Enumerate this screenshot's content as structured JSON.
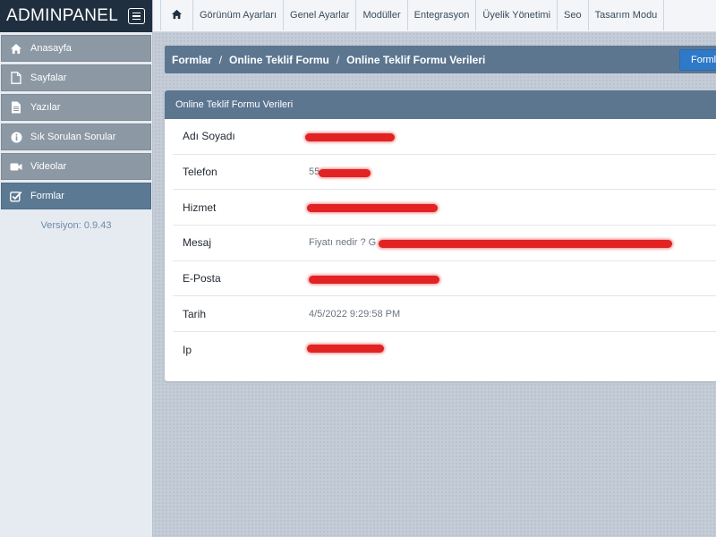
{
  "brand": {
    "title": "ADMINPANEL"
  },
  "sidebar": {
    "items": [
      {
        "label": "Anasayfa",
        "icon": "home-icon"
      },
      {
        "label": "Sayfalar",
        "icon": "file-icon"
      },
      {
        "label": "Yazılar",
        "icon": "document-icon"
      },
      {
        "label": "Sık Sorulan Sorular",
        "icon": "info-icon"
      },
      {
        "label": "Videolar",
        "icon": "video-camera-icon"
      },
      {
        "label": "Formlar",
        "icon": "checkbox-icon",
        "active": true
      }
    ],
    "version": "Versiyon: 0.9.43"
  },
  "topnav": {
    "items": [
      "Görünüm Ayarları",
      "Genel Ayarlar",
      "Modüller",
      "Entegrasyon",
      "Üyelik Yönetimi",
      "Seo",
      "Tasarım Modu"
    ]
  },
  "breadcrumb": {
    "items": [
      "Formlar",
      "Online Teklif Formu",
      "Online Teklif Formu Verileri"
    ],
    "separator": "/"
  },
  "header_button": {
    "label": "Formla"
  },
  "panel": {
    "title": "Online Teklif Formu Verileri",
    "rows": [
      {
        "label": "Adı Soyadı",
        "value": ""
      },
      {
        "label": "Telefon",
        "value": "55"
      },
      {
        "label": "Hizmet",
        "value": ""
      },
      {
        "label": "Mesaj",
        "value": "Fiyatı nedir ? G"
      },
      {
        "label": "E-Posta",
        "value": ""
      },
      {
        "label": "Tarih",
        "value": "4/5/2022 9:29:58 PM"
      },
      {
        "label": "Ip",
        "value": ""
      }
    ]
  },
  "colors": {
    "sidebar_active": "#5b7993",
    "sidebar_item": "#8c99a5",
    "brand_bg": "#1f2f3f",
    "header_bar": "#5c7690",
    "accent_button": "#2f79c9",
    "redaction": "#e01818"
  }
}
